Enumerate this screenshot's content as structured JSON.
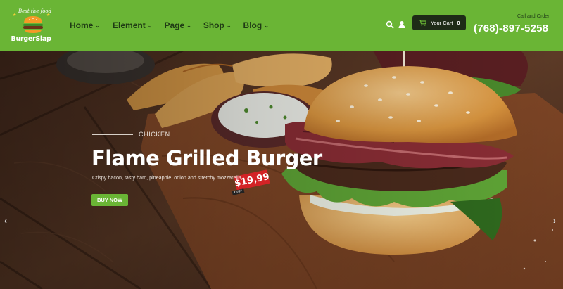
{
  "header": {
    "logo": {
      "tagline": "Best the food",
      "name": "BurgerSlap"
    },
    "nav": [
      {
        "label": "Home"
      },
      {
        "label": "Element"
      },
      {
        "label": "Page"
      },
      {
        "label": "Shop"
      },
      {
        "label": "Blog"
      }
    ],
    "search_icon": "search-icon",
    "user_icon": "user-icon",
    "cart": {
      "label": "Your Cart",
      "count": "0",
      "icon": "cart-icon"
    },
    "call_label": "Call and Order",
    "phone": "(768)-897-5258"
  },
  "hero": {
    "kicker": "CHICKEN",
    "title": "Flame Grilled Burger",
    "subtitle": "Crispy bacon, tasty ham, pineapple, onion and stretchy mozzarella.",
    "button": "BUY NOW",
    "price_tag": "$19,99",
    "price_note": "only"
  },
  "colors": {
    "brand_green": "#6ab535",
    "cart_bg": "#1e2b17",
    "price_red": "#d32326"
  }
}
